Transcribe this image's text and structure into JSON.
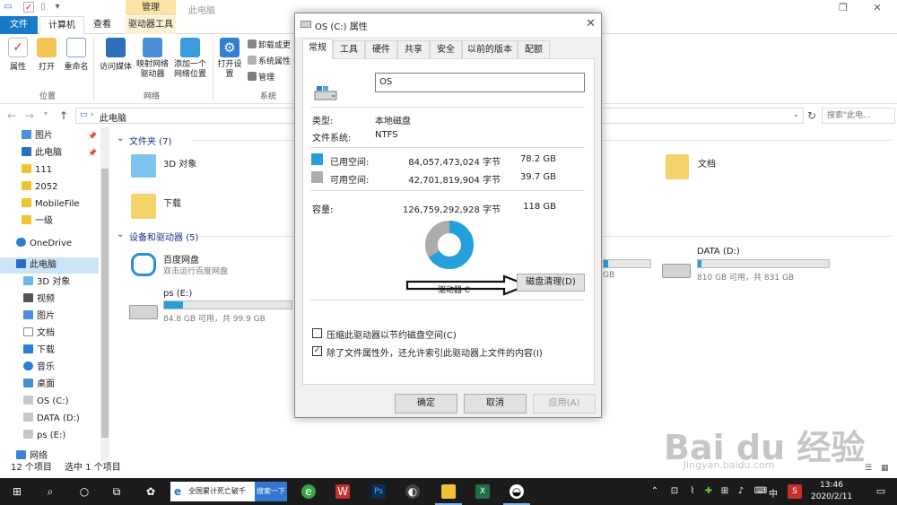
{
  "titlebar": {
    "contextual_group": "管理",
    "title": "此电脑"
  },
  "ribbon_tabs": [
    "文件",
    "计算机",
    "查看",
    "驱动器工具"
  ],
  "ribbon": {
    "property": "属性",
    "open": "打开",
    "rename": "重命名",
    "access_media": "访问媒体",
    "map_drive": "映射网络驱动器",
    "add_location": "添加一个网络位置",
    "open_settings": "打开设置",
    "uninstall": "卸载或更",
    "system_props": "系统属性",
    "manage": "管理",
    "group_location": "位置",
    "group_network": "网络",
    "group_system": "系统"
  },
  "address": {
    "path": "此电脑",
    "search_placeholder": "搜索\"此电..."
  },
  "nav": {
    "items": [
      "图片",
      "此电脑",
      "111",
      "2052",
      "MobileFile",
      "一级",
      "OneDrive",
      "此电脑",
      "3D 对象",
      "视频",
      "图片",
      "文档",
      "下载",
      "音乐",
      "桌面",
      "OS (C:)",
      "DATA (D:)",
      "ps (E:)",
      "网络"
    ]
  },
  "content": {
    "folders_header": "文件夹 (7)",
    "folder_3d": "3D 对象",
    "folder_docs": "文档",
    "folder_downloads": "下载",
    "devices_header": "设备和驱动器 (5)",
    "baidu_name": "百度网盘",
    "baidu_sub": "双击运行百度网盘",
    "ps_name": "ps (E:)",
    "ps_sub": "84.8 GB 可用，共 99.9 GB",
    "ps_used_fraction": 0.15,
    "data_name": "DATA (D:)",
    "data_sub": "810 GB 可用，共 831 GB",
    "data_used_fraction": 0.03,
    "hidden_drive_partial": "GB",
    "hidden_drive_used_fraction": 0.1
  },
  "status": {
    "count": "12 个项目",
    "selected": "选中 1 个项目"
  },
  "dialog": {
    "title": "OS (C:) 属性",
    "tabs": [
      "常规",
      "工具",
      "硬件",
      "共享",
      "安全",
      "以前的版本",
      "配额"
    ],
    "name_value": "OS",
    "type_label": "类型:",
    "type_value": "本地磁盘",
    "fs_label": "文件系统:",
    "fs_value": "NTFS",
    "used_label": "已用空间:",
    "used_bytes": "84,057,473,024 字节",
    "used_gb": "78.2 GB",
    "free_label": "可用空间:",
    "free_bytes": "42,701,819,904 字节",
    "free_gb": "39.7 GB",
    "cap_label": "容量:",
    "cap_bytes": "126,759,292,928 字节",
    "cap_gb": "118 GB",
    "drive_label": "驱动器 C",
    "cleanup_button": "磁盘清理(D)",
    "compress_option": "压缩此驱动器以节约磁盘空间(C)",
    "index_option": "除了文件属性外，还允许索引此驱动器上文件的内容(I)",
    "ok": "确定",
    "cancel": "取消",
    "apply": "应用(A)",
    "used_fraction": 0.663,
    "used_color": "#26a0da",
    "free_color": "#acacac"
  },
  "taskbar": {
    "search_text": "全国累计死亡破千",
    "search_button": "搜索一下",
    "ime": "中",
    "time": "13:46",
    "date": "2020/2/11"
  },
  "watermark": {
    "brand": "Bai du 经验",
    "url": "jingyan.baidu.com"
  }
}
